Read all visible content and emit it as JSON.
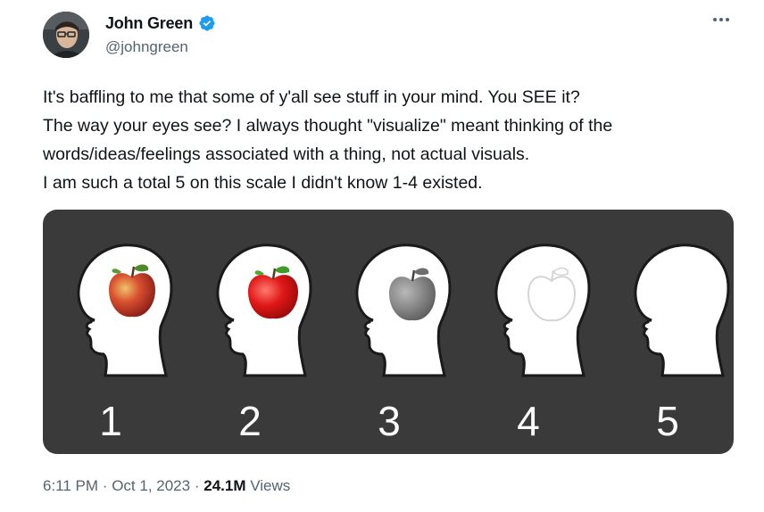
{
  "author": {
    "display_name": "John Green",
    "handle": "@johngreen",
    "verified": true,
    "verified_icon": "verified-badge-icon",
    "verified_color": "#1d9bf0"
  },
  "more_icon": "more-horizontal-icon",
  "tweet": {
    "lines": [
      "It's baffling to me that some of y'all see stuff in your mind. You SEE it?",
      "The way your eyes see? I always thought \"visualize\" meant thinking of the",
      "words/ideas/feelings associated with a thing, not actual visuals.",
      "I am such a total 5 on this scale I didn't know 1-4 existed."
    ]
  },
  "media": {
    "background_color": "#3a3a3a",
    "scale_labels": [
      "1",
      "2",
      "3",
      "4",
      "5"
    ],
    "heads": [
      {
        "label": "1",
        "apple": "realistic"
      },
      {
        "label": "2",
        "apple": "vivid red"
      },
      {
        "label": "3",
        "apple": "grayscale"
      },
      {
        "label": "4",
        "apple": "outline"
      },
      {
        "label": "5",
        "apple": "none"
      }
    ]
  },
  "footer": {
    "time": "6:11 PM",
    "separator": "·",
    "date": "Oct 1, 2023",
    "views_count": "24.1M",
    "views_label": "Views"
  }
}
